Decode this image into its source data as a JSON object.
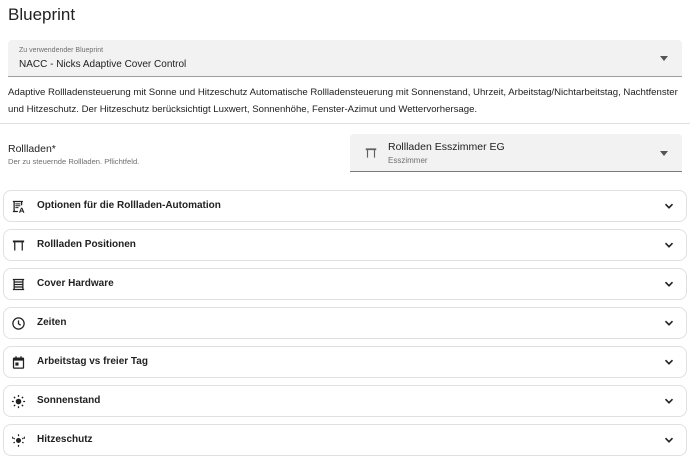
{
  "page": {
    "title": "Blueprint"
  },
  "blueprint_select": {
    "label": "Zu verwendender Blueprint",
    "value": "NACC - Nicks Adaptive Cover Control",
    "icon": "chevron-down-icon"
  },
  "description": "Adaptive Rollladensteuerung mit Sonne und Hitzeschutz Automatische Rollladensteuerung mit Sonnenstand, Uhrzeit, Arbeitstag/Nichtarbeitstag, Nachtfenster und Hitzeschutz. Der Hitzeschutz berücksichtigt Luxwert, Sonnenhöhe, Fenster-Azimut und Wettervorhersage.",
  "rollladen_field": {
    "title": "Rollladen*",
    "description": "Der zu steuernde Rollladen. Pflichtfeld.",
    "entity_name": "Rollladen Esszimmer EG",
    "entity_area": "Esszimmer",
    "icon": "window-shutter-icon"
  },
  "sections": [
    {
      "title": "Optionen für die Rollladen-Automation",
      "icon": "shutter-auto-icon"
    },
    {
      "title": "Rollladen Positionen",
      "icon": "window-shutter-icon"
    },
    {
      "title": "Cover Hardware",
      "icon": "shutter-closed-icon"
    },
    {
      "title": "Zeiten",
      "icon": "clock-icon"
    },
    {
      "title": "Arbeitstag vs freier Tag",
      "icon": "calendar-icon"
    },
    {
      "title": "Sonnenstand",
      "icon": "sun-icon"
    },
    {
      "title": "Hitzeschutz",
      "icon": "heat-protection-icon"
    }
  ],
  "colors": {
    "field_bg": "#f2f2f2",
    "text": "#212121",
    "secondary_text": "#6f6f6f",
    "border": "#e0e0e0"
  }
}
